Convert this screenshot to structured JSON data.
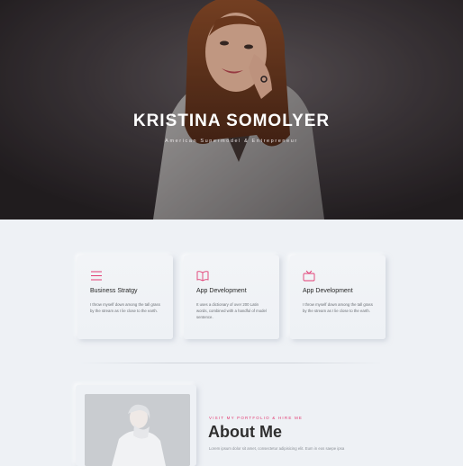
{
  "hero": {
    "name": "KRISTINA SOMOLYER",
    "subtitle": "American Supermodel & Entrepreneur"
  },
  "services": [
    {
      "icon": "menu-icon",
      "title": "Business Stratgy",
      "description": "I throw myself down among the tall grass by the stream as I lie close to the earth."
    },
    {
      "icon": "book-icon",
      "title": "App Development",
      "description": "It uses a dictionary of over 200 Latin words, combined with a handful of model sentence."
    },
    {
      "icon": "tv-icon",
      "title": "App Development",
      "description": "I throw myself down among the tall grass by the stream as I lie close to the earth."
    }
  ],
  "about": {
    "kicker": "VISIT MY PORTFOLIO & HIRE ME",
    "title": "About Me",
    "text": "Lorem ipsum dolor sit amet, consectetur adipisicing elit. Eum in eos saepe ipsa"
  },
  "colors": {
    "accent": "#e23c73",
    "background": "#eef1f5"
  }
}
